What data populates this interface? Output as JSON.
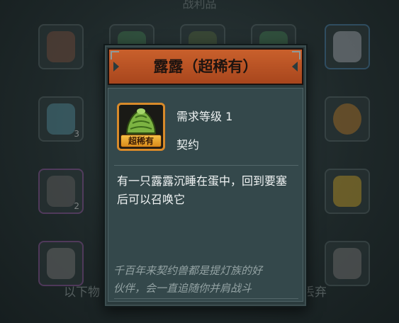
{
  "background": {
    "title": "战利品",
    "footer_left": "以下物",
    "footer_right": "或丢弃",
    "slot_counts": [
      "3",
      "2"
    ]
  },
  "popup": {
    "title": "露露（超稀有）",
    "rarity_tag": "超稀有",
    "required_level": "需求等级 1",
    "item_type": "契约",
    "description": "有一只露露沉睡在蛋中，回到要塞后可以召唤它",
    "flavor_line1": "千百年来契约兽都是提灯族的好",
    "flavor_line2": "伙伴，会一直追随你并肩战斗"
  },
  "colors": {
    "header": "#c05427",
    "rarity_gold": "#e8a32e",
    "panel": "#34484b"
  }
}
